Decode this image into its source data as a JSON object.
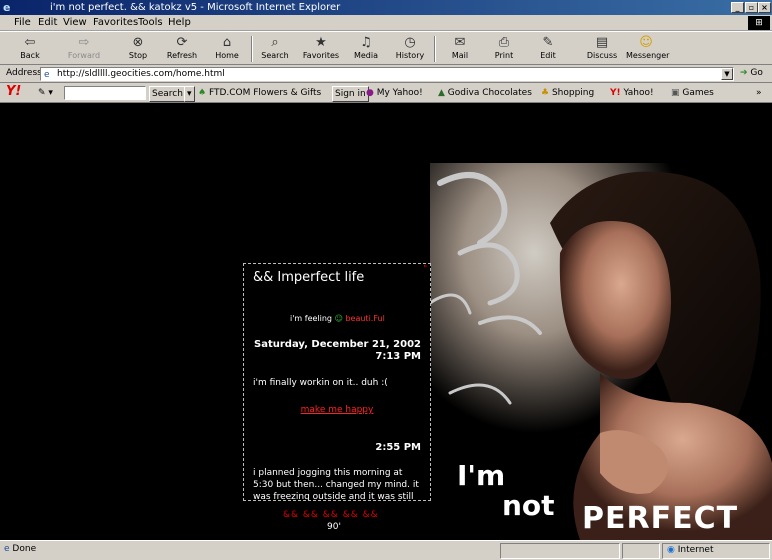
{
  "window": {
    "title": "i'm not perfect.      &&     katokz v5  - Microsoft Internet Explorer",
    "ie_icon": "e",
    "btn_min": "_",
    "btn_max": "▫",
    "btn_close": "×"
  },
  "menu": {
    "items": [
      "File",
      "Edit",
      "View",
      "Favorites",
      "Tools",
      "Help"
    ],
    "windows_logo": "⊞"
  },
  "toolbar": {
    "buttons": [
      {
        "label": "Back",
        "icon": "back-arrow-icon",
        "glyph": "⇦"
      },
      {
        "label": "Forward",
        "icon": "forward-arrow-icon",
        "glyph": "⇨"
      },
      {
        "label": "Stop",
        "icon": "stop-icon",
        "glyph": "⊗"
      },
      {
        "label": "Refresh",
        "icon": "refresh-icon",
        "glyph": "⟳"
      },
      {
        "label": "Home",
        "icon": "home-icon",
        "glyph": "⌂"
      },
      {
        "label": "Search",
        "icon": "search-icon",
        "glyph": "⌕"
      },
      {
        "label": "Favorites",
        "icon": "favorites-icon",
        "glyph": "★"
      },
      {
        "label": "Media",
        "icon": "media-icon",
        "glyph": "♫"
      },
      {
        "label": "History",
        "icon": "history-icon",
        "glyph": "◷"
      },
      {
        "label": "Mail",
        "icon": "mail-icon",
        "glyph": "✉"
      },
      {
        "label": "Print",
        "icon": "print-icon",
        "glyph": "⎙"
      },
      {
        "label": "Edit",
        "icon": "edit-icon",
        "glyph": "✎"
      },
      {
        "label": "Discuss",
        "icon": "discuss-icon",
        "glyph": "▤"
      },
      {
        "label": "Messenger",
        "icon": "messenger-icon",
        "glyph": "☺"
      }
    ]
  },
  "address": {
    "label": "Address",
    "url": "http://sldllll.geocities.com/home.html",
    "go_label": "Go",
    "page_icon": "e",
    "drop_glyph": "▼"
  },
  "yahoo": {
    "logo": "Y!",
    "pencil": "✎ ▾",
    "search_label": "Search",
    "caret": "▾",
    "items": [
      {
        "text": "FTD.COM Flowers & Gifts",
        "icon": "flower-icon"
      },
      {
        "text": "Sign in",
        "icon": ""
      },
      {
        "text": "My Yahoo!",
        "icon": "my-yahoo-icon"
      },
      {
        "text": "Godiva Chocolates",
        "icon": "chocolate-icon"
      },
      {
        "text": "Shopping",
        "icon": "shopping-icon"
      },
      {
        "text": "Yahoo!",
        "icon": "yahoo-icon"
      },
      {
        "text": "Games",
        "icon": "games-icon"
      }
    ],
    "more": "»"
  },
  "journal": {
    "title": "&& Imperfect life",
    "corner_mark": "\"",
    "mood_label": "i'm feeling",
    "mood_icon": "☺",
    "mood_value": "beauti.Ful",
    "date": "Saturday, December 21, 2002",
    "time1": "7:13 PM",
    "entry1": "i'm finally workin on it.. duh :(",
    "link": "make me happy",
    "time2": "2:55 PM",
    "entry2": "i planned jogging this morning at 5:30 but then... changed my mind. it was freezing outside and it was still dark",
    "entry2_arrow": "→"
  },
  "footer": {
    "marks": "&& && && && &&",
    "number": "90'"
  },
  "slogan": {
    "line1": "I'm",
    "line2": "not",
    "line3": "PERFECT"
  },
  "status": {
    "text": "Done",
    "zone": "Internet",
    "page_icon": "e"
  },
  "colors": {
    "accent_red": "#ff2020",
    "titlebar": "#0a246a",
    "chrome": "#d4d0c8"
  }
}
